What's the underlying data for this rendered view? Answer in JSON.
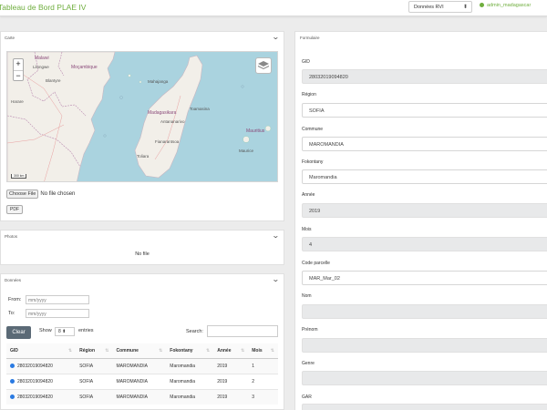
{
  "navbar": {
    "brand": "Tableau de Bord PLAE IV",
    "select_value": "Données RVI",
    "user": "admin_madagascar"
  },
  "carte": {
    "title": "Carte",
    "zoom_in": "+",
    "zoom_out": "−",
    "scale": "300 km",
    "labels": [
      "Malawi",
      "Moçambique",
      "Lilongwe",
      "Blantyre",
      "Mahajanga",
      "Madagasikara",
      "Toamasina",
      "Antananarivo",
      "Fianarantsoa",
      "Toliara",
      "Mauritius",
      "Maurice",
      "Harare"
    ],
    "file_button": "Choose File",
    "file_status": "No file chosen",
    "pdf_button": "PDF"
  },
  "photos": {
    "title": "Photos",
    "status": "No file"
  },
  "donnees": {
    "title": "Données",
    "from_label": "From:",
    "to_label": "To:",
    "date_placeholder": "mm/yyyy",
    "clear_button": "Clear",
    "show_label": "Show",
    "entries_value": "8",
    "entries_label": "entries",
    "search_label": "Search:",
    "columns": [
      "GID",
      "Région",
      "Commune",
      "Fokontany",
      "Année",
      "Mois"
    ],
    "rows": [
      [
        "28032019094820",
        "SOFIA",
        "MAROMANDIA",
        "Maromandia",
        "2019",
        "1"
      ],
      [
        "28032019094820",
        "SOFIA",
        "MAROMANDIA",
        "Maromandia",
        "2019",
        "2"
      ],
      [
        "28032019094820",
        "SOFIA",
        "MAROMANDIA",
        "Maromandia",
        "2019",
        "3"
      ]
    ]
  },
  "formulaire": {
    "title": "Formulaire",
    "fields": [
      {
        "label": "GID",
        "value": "28032019094820"
      },
      {
        "label": "Région",
        "value": "SOFIA"
      },
      {
        "label": "Commune",
        "value": "MAROMANDIA"
      },
      {
        "label": "Fokontany",
        "value": "Maromandia"
      },
      {
        "label": "Année",
        "value": "2019"
      },
      {
        "label": "Mois",
        "value": "4"
      },
      {
        "label": "Code parcelle",
        "value": "MAR_Mar_02"
      },
      {
        "label": "Nom",
        "value": ""
      },
      {
        "label": "Prénom",
        "value": ""
      },
      {
        "label": "Genre",
        "value": ""
      },
      {
        "label": "GAR",
        "value": ""
      }
    ]
  }
}
